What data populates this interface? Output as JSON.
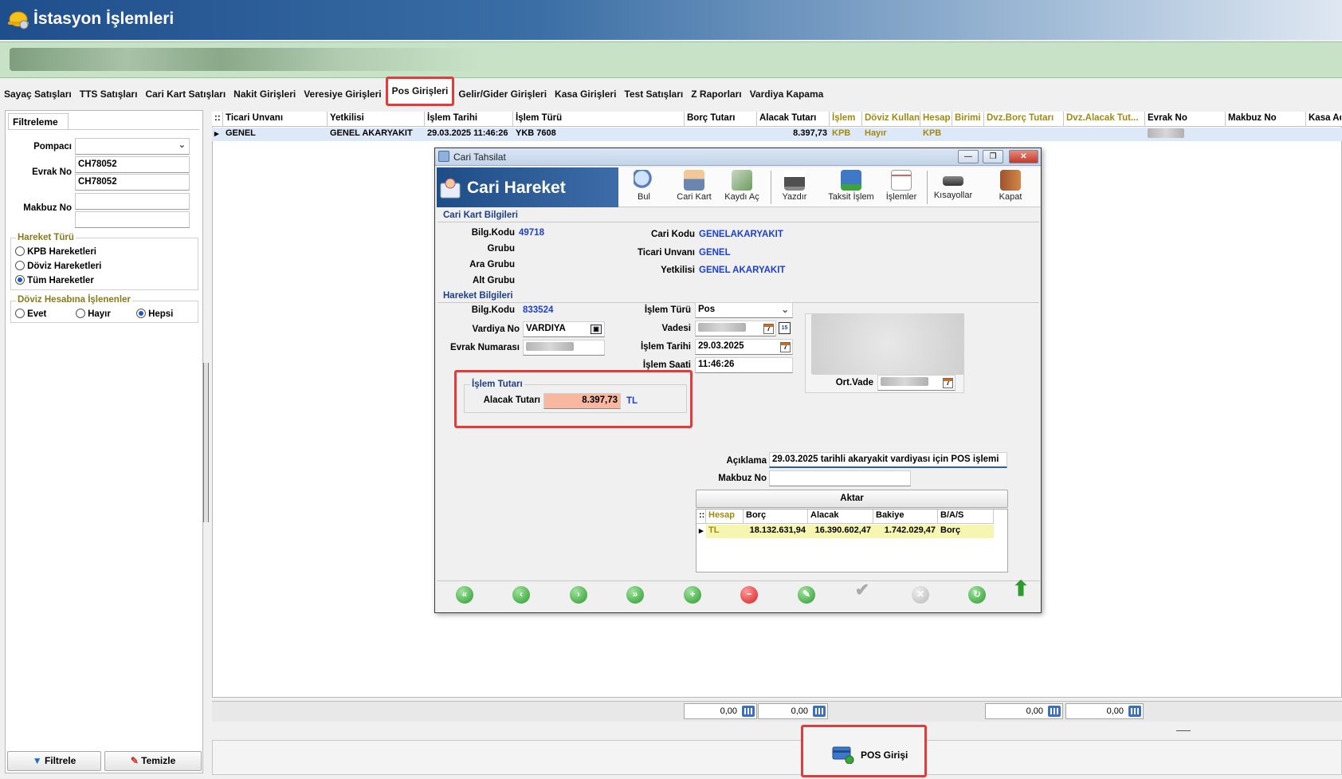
{
  "app": {
    "title": "İstasyon İşlemleri",
    "icon": "worker-helmet-icon"
  },
  "tabs": [
    "Sayaç Satışları",
    "TTS Satışları",
    "Cari Kart Satışları",
    "Nakit Girişleri",
    "Veresiye Girişleri",
    "Pos Girişleri",
    "Gelir/Gider Girişleri",
    "Kasa Girişleri",
    "Test Satışları",
    "Z Raporları",
    "Vardiya Kapama"
  ],
  "active_tab": "Pos Girişleri",
  "filter": {
    "tab_label": "Filtreleme",
    "pompaci_label": "Pompacı",
    "pompaci_value": "",
    "evrak_no_label": "Evrak No",
    "evrak_no_1": "CH78052",
    "evrak_no_2": "CH78052",
    "makbuz_no_label": "Makbuz No",
    "makbuz_no_1": "",
    "makbuz_no_2": "",
    "hareket_turu": {
      "title": "Hareket Türü",
      "options": [
        "KPB Hareketleri",
        "Döviz Hareketleri",
        "Tüm Hareketler"
      ],
      "selected": "Tüm Hareketler"
    },
    "doviz": {
      "title": "Döviz Hesabına İşlenenler",
      "options": [
        "Evet",
        "Hayır",
        "Hepsi"
      ],
      "selected": "Hepsi"
    },
    "filtrele_label": "Filtrele",
    "temizle_label": "Temizle"
  },
  "grid": {
    "columns": [
      "::",
      "Ticari Unvanı",
      "Yetkilisi",
      "İşlem Tarihi",
      "İşlem Türü",
      "Borç Tutarı",
      "Alacak Tutarı",
      "İşlem",
      "Döviz Kullan",
      "Hesap",
      "Birimi",
      "Dvz.Borç Tutarı",
      "Dvz.Alacak Tut...",
      "Evrak No",
      "Makbuz No",
      "Kasa Ad"
    ],
    "rows": [
      {
        "ticari_unvani": "GENEL",
        "yetkilisi": "GENEL AKARYAKIT",
        "islem_tarihi": "29.03.2025 11:46:26",
        "islem_turu": "YKB 7608",
        "borc": "",
        "alacak": "8.397,73",
        "islem": "KPB",
        "doviz_kullan": "Hayır",
        "hesap": "KPB",
        "birimi": "",
        "dvz_borc": "",
        "dvz_alacak": "",
        "evrak_no": "",
        "makbuz_no": "",
        "kasa_ad": ""
      }
    ],
    "totals": [
      "0,00",
      "0,00",
      "0,00",
      "0,00"
    ],
    "pos_girisi_label": "POS Girişi"
  },
  "dialog": {
    "window_title": "Cari Tahsilat",
    "header": "Cari Hareket",
    "toolbar": [
      "Bul",
      "Cari Kart",
      "Kaydı Aç",
      "Yazdır",
      "Taksit İşlem",
      "İşlemler",
      "Kısayollar",
      "Kapat"
    ],
    "cari_kart": {
      "title": "Cari Kart Bilgileri",
      "bilg_kodu_label": "Bilg.Kodu",
      "bilg_kodu": "49718",
      "grubu_label": "Grubu",
      "ara_grubu_label": "Ara Grubu",
      "alt_grubu_label": "Alt Grubu",
      "cari_kodu_label": "Cari Kodu",
      "cari_kodu": "GENELAKARYAKIT",
      "ticari_unvani_label": "Ticari Unvanı",
      "ticari_unvani": "GENEL",
      "yetkilisi_label": "Yetkilisi",
      "yetkilisi": "GENEL AKARYAKIT"
    },
    "hareket": {
      "title": "Hareket Bilgileri",
      "bilg_kodu_label": "Bilg.Kodu",
      "bilg_kodu": "833524",
      "vardiya_no_label": "Vardiya No",
      "vardiya_no": "VARDIYA",
      "evrak_numarasi_label": "Evrak Numarası",
      "islem_turu_label": "İşlem Türü",
      "islem_turu": "Pos",
      "vadesi_label": "Vadesi",
      "islem_tarihi_label": "İşlem Tarihi",
      "islem_tarihi": "29.03.2025",
      "islem_saati_label": "İşlem Saati",
      "islem_saati": "11:46:26",
      "ort_vade_label": "Ort.Vade"
    },
    "islem_tutari": {
      "title": "İşlem Tutarı",
      "alacak_label": "Alacak Tutarı",
      "alacak_value": "8.397,73",
      "currency": "TL"
    },
    "aciklama_label": "Açıklama",
    "aciklama": "29.03.2025 tarihli akaryakit vardiyası için POS işlemi",
    "makbuz_no_label": "Makbuz No",
    "makbuz_no": "",
    "aktar_label": "Aktar",
    "balance": {
      "columns": [
        "::",
        "Hesap",
        "Borç",
        "Alacak",
        "Bakiye",
        "B/A/S"
      ],
      "rows": [
        {
          "hesap": "TL",
          "borc": "18.132.631,94",
          "alacak": "16.390.602,47",
          "bakiye": "1.742.029,47",
          "bas": "Borç"
        }
      ]
    },
    "nav": [
      "first",
      "prev",
      "next",
      "last",
      "add",
      "delete",
      "edit",
      "post",
      "cancel",
      "refresh",
      "up"
    ]
  },
  "colors": {
    "accent_blue": "#1d3fcf",
    "highlight_red": "#e03c3c",
    "alacak_bg": "#f7b7a0",
    "olive": "#a08a10"
  }
}
